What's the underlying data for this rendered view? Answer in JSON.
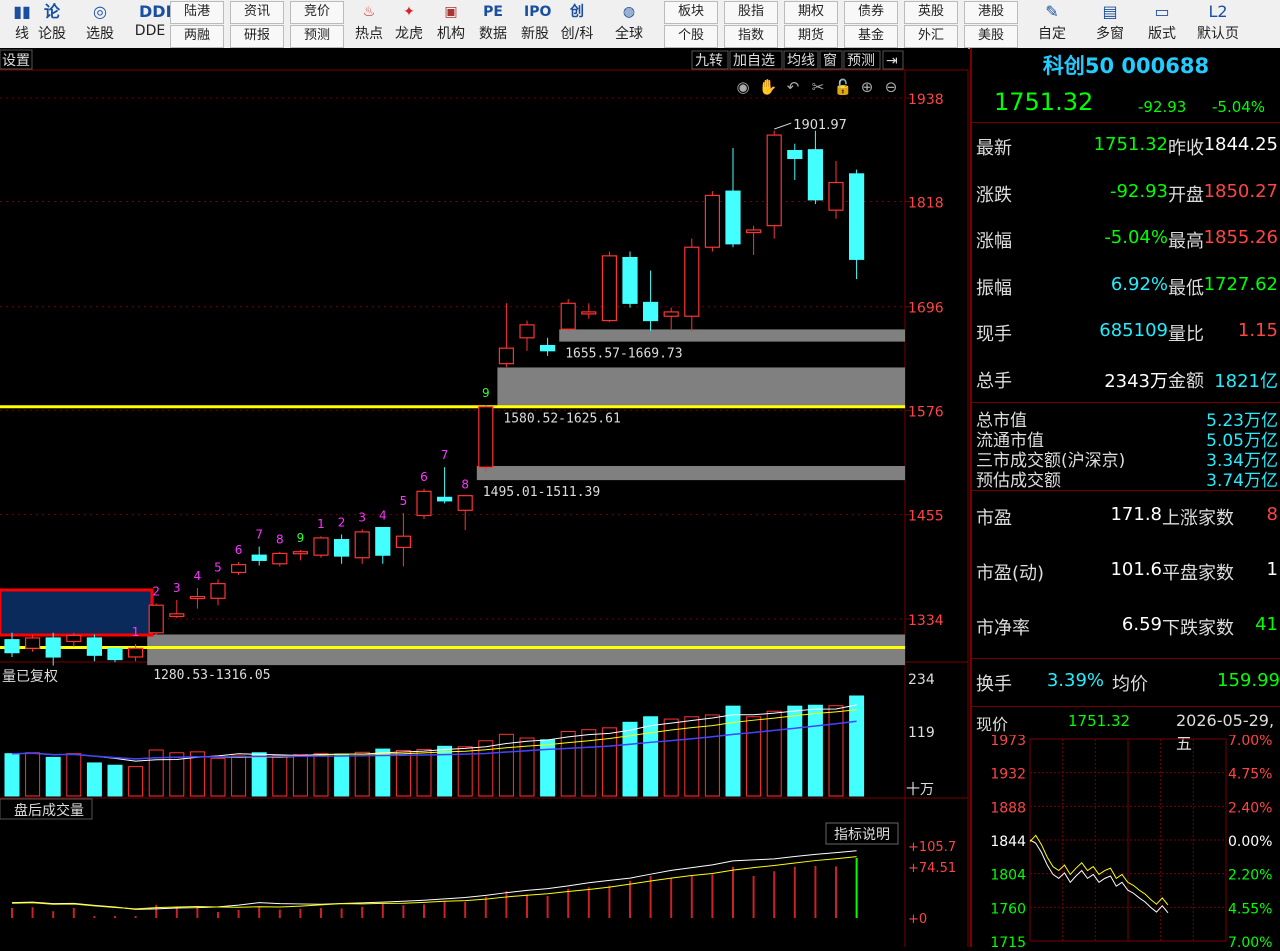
{
  "toolbar": {
    "items": [
      {
        "label": "线",
        "icon": "kline-icon"
      },
      {
        "label": "论股",
        "icon": "discuss-icon"
      },
      {
        "label": "选股",
        "icon": "select-stock-icon"
      },
      {
        "label": "DDE",
        "icon": "dde-icon"
      }
    ],
    "pairs": [
      {
        "top": "陆港",
        "bottom": "两融"
      },
      {
        "top": "资讯",
        "bottom": "研报"
      },
      {
        "top": "竞价",
        "bottom": "预测"
      }
    ],
    "items2": [
      {
        "label": "热点"
      },
      {
        "label": "龙虎"
      },
      {
        "label": "机构"
      },
      {
        "label": "数据"
      },
      {
        "label": "新股"
      },
      {
        "label": "创/科"
      },
      {
        "label": "全球"
      }
    ],
    "pairs2": [
      {
        "top": "板块",
        "bottom": "个股"
      },
      {
        "top": "股指",
        "bottom": "指数"
      },
      {
        "top": "期权",
        "bottom": "期货"
      },
      {
        "top": "债券",
        "bottom": "基金"
      },
      {
        "top": "英股",
        "bottom": "外汇"
      },
      {
        "top": "港股",
        "bottom": "美股"
      }
    ],
    "items3": [
      {
        "label": "自定"
      },
      {
        "label": "多窗"
      },
      {
        "label": "版式"
      },
      {
        "label": "默认页"
      }
    ],
    "l2": "L2"
  },
  "chart": {
    "settings_label": "设置",
    "tools": [
      "九转",
      "加自选",
      "均线",
      "窗",
      "预测"
    ],
    "y_labels": [
      "1938",
      "1818",
      "1696",
      "1576",
      "1455",
      "1334"
    ],
    "high_label": "1901.97",
    "gaps": [
      "1655.57-1669.73",
      "1580.52-1625.61",
      "1495.01-1511.39",
      "1280.53-1316.05"
    ],
    "td_counts": [
      "1",
      "2",
      "3",
      "4",
      "5",
      "6",
      "7",
      "8",
      "9",
      "1",
      "2",
      "3",
      "4",
      "5",
      "6",
      "7",
      "8",
      "9"
    ],
    "volume_title": "量已复权",
    "volume_y": [
      "234",
      "119",
      "十万"
    ],
    "after_volume_title": "盘后成交量",
    "indicator_btn": "指标说明",
    "ind_y": [
      "+105.7",
      "+74.51",
      "+0"
    ]
  },
  "chart_data": {
    "type": "candlestick",
    "y_ticks": [
      1334,
      1455,
      1576,
      1696,
      1818,
      1938
    ],
    "candles": [
      {
        "o": 1295,
        "h": 1318,
        "l": 1290,
        "c": 1310,
        "up": false
      },
      {
        "o": 1300,
        "h": 1316,
        "l": 1296,
        "c": 1312,
        "up": true
      },
      {
        "o": 1312,
        "h": 1318,
        "l": 1280,
        "c": 1290,
        "up": false
      },
      {
        "o": 1308,
        "h": 1318,
        "l": 1302,
        "c": 1315,
        "up": true
      },
      {
        "o": 1312,
        "h": 1316,
        "l": 1285,
        "c": 1292,
        "up": false
      },
      {
        "o": 1300,
        "h": 1300,
        "l": 1284,
        "c": 1287,
        "up": false
      },
      {
        "o": 1290,
        "h": 1305,
        "l": 1285,
        "c": 1300,
        "up": true
      },
      {
        "o": 1318,
        "h": 1352,
        "l": 1316,
        "c": 1350,
        "up": true
      },
      {
        "o": 1337,
        "h": 1356,
        "l": 1335,
        "c": 1340,
        "up": true
      },
      {
        "o": 1358,
        "h": 1370,
        "l": 1346,
        "c": 1360,
        "up": true
      },
      {
        "o": 1358,
        "h": 1380,
        "l": 1350,
        "c": 1375,
        "up": true
      },
      {
        "o": 1388,
        "h": 1400,
        "l": 1385,
        "c": 1397,
        "up": true
      },
      {
        "o": 1402,
        "h": 1418,
        "l": 1396,
        "c": 1408,
        "up": false
      },
      {
        "o": 1398,
        "h": 1412,
        "l": 1395,
        "c": 1410,
        "up": true
      },
      {
        "o": 1410,
        "h": 1414,
        "l": 1402,
        "c": 1412,
        "up": true
      },
      {
        "o": 1408,
        "h": 1430,
        "l": 1405,
        "c": 1428,
        "up": true
      },
      {
        "o": 1426,
        "h": 1432,
        "l": 1398,
        "c": 1407,
        "up": false
      },
      {
        "o": 1405,
        "h": 1438,
        "l": 1398,
        "c": 1435,
        "up": true
      },
      {
        "o": 1440,
        "h": 1440,
        "l": 1398,
        "c": 1408,
        "up": false
      },
      {
        "o": 1417,
        "h": 1457,
        "l": 1395,
        "c": 1430,
        "up": true
      },
      {
        "o": 1454,
        "h": 1485,
        "l": 1450,
        "c": 1482,
        "up": true
      },
      {
        "o": 1475,
        "h": 1510,
        "l": 1468,
        "c": 1471,
        "up": false
      },
      {
        "o": 1460,
        "h": 1476,
        "l": 1437,
        "c": 1477,
        "up": true
      },
      {
        "o": 1510,
        "h": 1582,
        "l": 1505,
        "c": 1580,
        "up": true
      },
      {
        "o": 1630,
        "h": 1700,
        "l": 1626,
        "c": 1648,
        "up": true
      },
      {
        "o": 1660,
        "h": 1680,
        "l": 1645,
        "c": 1675,
        "up": true
      },
      {
        "o": 1651,
        "h": 1660,
        "l": 1639,
        "c": 1645,
        "up": false
      },
      {
        "o": 1670,
        "h": 1705,
        "l": 1668,
        "c": 1700,
        "up": true
      },
      {
        "o": 1688,
        "h": 1700,
        "l": 1682,
        "c": 1690,
        "up": true
      },
      {
        "o": 1680,
        "h": 1760,
        "l": 1678,
        "c": 1755,
        "up": true
      },
      {
        "o": 1753,
        "h": 1760,
        "l": 1695,
        "c": 1700,
        "up": false
      },
      {
        "o": 1701,
        "h": 1738,
        "l": 1668,
        "c": 1680,
        "up": false
      },
      {
        "o": 1685,
        "h": 1695,
        "l": 1670,
        "c": 1690,
        "up": true
      },
      {
        "o": 1685,
        "h": 1775,
        "l": 1667,
        "c": 1765,
        "up": true
      },
      {
        "o": 1765,
        "h": 1830,
        "l": 1760,
        "c": 1825,
        "up": true
      },
      {
        "o": 1830,
        "h": 1880,
        "l": 1765,
        "c": 1769,
        "up": false
      },
      {
        "o": 1782,
        "h": 1790,
        "l": 1756,
        "c": 1785,
        "up": true
      },
      {
        "o": 1790,
        "h": 1900,
        "l": 1775,
        "c": 1895,
        "up": true
      },
      {
        "o": 1877,
        "h": 1885,
        "l": 1843,
        "c": 1868,
        "up": false
      },
      {
        "o": 1878,
        "h": 1900,
        "l": 1815,
        "c": 1820,
        "up": false
      },
      {
        "o": 1808,
        "h": 1865,
        "l": 1798,
        "c": 1840,
        "up": true
      },
      {
        "o": 1850,
        "h": 1855,
        "l": 1728,
        "c": 1751,
        "up": false
      }
    ],
    "td_marks": [
      {
        "i": 6,
        "t": "1",
        "c": "m"
      },
      {
        "i": 7,
        "t": "2",
        "c": "m"
      },
      {
        "i": 8,
        "t": "3",
        "c": "m"
      },
      {
        "i": 9,
        "t": "4",
        "c": "m"
      },
      {
        "i": 10,
        "t": "5",
        "c": "m"
      },
      {
        "i": 11,
        "t": "6",
        "c": "m"
      },
      {
        "i": 12,
        "t": "7",
        "c": "m"
      },
      {
        "i": 13,
        "t": "8",
        "c": "m"
      },
      {
        "i": 14,
        "t": "9",
        "c": "g"
      },
      {
        "i": 15,
        "t": "1",
        "c": "m"
      },
      {
        "i": 16,
        "t": "2",
        "c": "m"
      },
      {
        "i": 17,
        "t": "3",
        "c": "m"
      },
      {
        "i": 18,
        "t": "4",
        "c": "m"
      },
      {
        "i": 19,
        "t": "5",
        "c": "m"
      },
      {
        "i": 20,
        "t": "6",
        "c": "m"
      },
      {
        "i": 21,
        "t": "7",
        "c": "m"
      },
      {
        "i": 22,
        "t": "8",
        "c": "m"
      },
      {
        "i": 23,
        "t": "9",
        "c": "g"
      }
    ],
    "gap_zones": [
      {
        "lo": 1655.57,
        "hi": 1669.73,
        "from": 27
      },
      {
        "lo": 1580.52,
        "hi": 1625.61,
        "from": 24
      },
      {
        "lo": 1495.01,
        "hi": 1511.39,
        "from": 23
      },
      {
        "lo": 1280.53,
        "hi": 1316.05,
        "from": 7
      }
    ],
    "yellow_lines": [
      1580,
      1301
    ],
    "volume": [
      70,
      72,
      62,
      70,
      50,
      45,
      42,
      78,
      72,
      74,
      60,
      65,
      72,
      66,
      68,
      70,
      69,
      73,
      80,
      77,
      79,
      86,
      85,
      98,
      112,
      104,
      100,
      118,
      122,
      126,
      138,
      150,
      145,
      150,
      154,
      173,
      150,
      162,
      173,
      175,
      174,
      195
    ],
    "volume_ticks": [
      119,
      234
    ],
    "ind_ticks": [
      0,
      74.51,
      105.7
    ]
  },
  "right_panel": {
    "title": "科创50 000688",
    "price": "1751.32",
    "change": "-92.93",
    "pct": "-5.04%",
    "quote_rows": [
      {
        "l1": "最新",
        "v1": "1751.32",
        "c1": "grn",
        "l2": "昨收",
        "v2": "1844.25",
        "c2": "wht"
      },
      {
        "l1": "涨跌",
        "v1": "-92.93",
        "c1": "grn",
        "l2": "开盘",
        "v2": "1850.27",
        "c2": "red"
      },
      {
        "l1": "涨幅",
        "v1": "-5.04%",
        "c1": "grn",
        "l2": "最高",
        "v2": "1855.26",
        "c2": "red"
      },
      {
        "l1": "振幅",
        "v1": "6.92%",
        "c1": "cyn",
        "l2": "最低",
        "v2": "1727.62",
        "c2": "grn"
      },
      {
        "l1": "现手",
        "v1": "685109",
        "c1": "cyn",
        "l2": "量比",
        "v2": "1.15",
        "c2": "red"
      },
      {
        "l1": "总手",
        "v1": "2343万",
        "c1": "wht",
        "l2": "金额",
        "v2": "1821亿",
        "c2": "cyn"
      }
    ],
    "market_rows": [
      {
        "label": "总市值",
        "value": "5.23万亿"
      },
      {
        "label": "流通市值",
        "value": "5.05万亿"
      },
      {
        "label": "三市成交额(沪深京)",
        "value": "3.34万亿"
      },
      {
        "label": "预估成交额",
        "value": "3.74万亿"
      }
    ],
    "stat_rows": [
      {
        "l1": "市盈",
        "v1": "171.8",
        "l2": "上涨家数",
        "v2": "8",
        "c2": "red"
      },
      {
        "l1": "市盈(动)",
        "v1": "101.6",
        "l2": "平盘家数",
        "v2": "1",
        "c2": "wht"
      },
      {
        "l1": "市净率",
        "v1": "6.59",
        "l2": "下跌家数",
        "v2": "41",
        "c2": "grn"
      }
    ],
    "turnover": {
      "l1": "换手",
      "v1": "3.39%",
      "l2": "均价",
      "v2": "159.99"
    },
    "mini": {
      "label": "现价",
      "price": "1751.32",
      "date": "2026-05-29,五",
      "y_left": [
        "1973",
        "1932",
        "1888",
        "1844",
        "1804",
        "1760",
        "1715"
      ],
      "y_right": [
        "7.00%",
        "4.75%",
        "2.40%",
        "0.00%",
        "2.20%",
        "4.55%",
        "7.00%"
      ]
    }
  }
}
